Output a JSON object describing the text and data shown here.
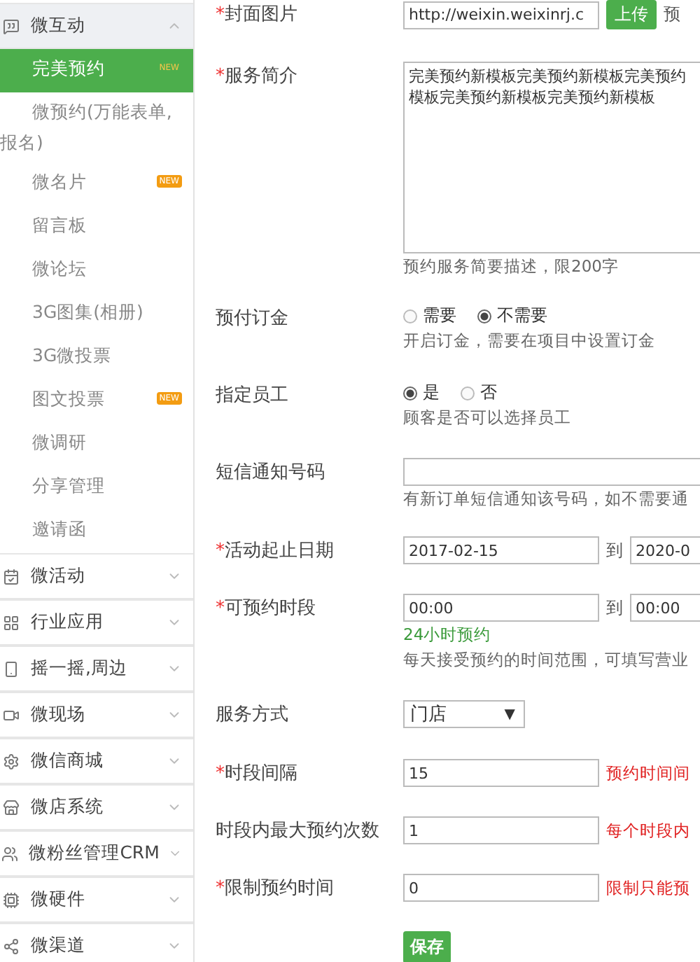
{
  "sidebar": {
    "groups": [
      {
        "label": "微互动",
        "expanded": true,
        "children": [
          {
            "label": "完美预约",
            "selected": true,
            "badge": "NEW"
          },
          {
            "label": "微预约(万能表单,报名)",
            "selected": false
          },
          {
            "label": "微名片",
            "selected": false,
            "badge": "NEW"
          },
          {
            "label": "留言板",
            "selected": false
          },
          {
            "label": "微论坛",
            "selected": false
          },
          {
            "label": "3G图集(相册)",
            "selected": false
          },
          {
            "label": "3G微投票",
            "selected": false
          },
          {
            "label": "图文投票",
            "selected": false,
            "badge": "NEW"
          },
          {
            "label": "微调研",
            "selected": false
          },
          {
            "label": "分享管理",
            "selected": false
          },
          {
            "label": "邀请函",
            "selected": false
          }
        ]
      },
      {
        "label": "微活动",
        "expanded": false
      },
      {
        "label": "行业应用",
        "expanded": false
      },
      {
        "label": "摇一摇,周边",
        "expanded": false
      },
      {
        "label": "微现场",
        "expanded": false
      },
      {
        "label": "微信商城",
        "expanded": false
      },
      {
        "label": "微店系统",
        "expanded": false
      },
      {
        "label": "微粉丝管理CRM",
        "expanded": false
      },
      {
        "label": "微硬件",
        "expanded": false
      },
      {
        "label": "微渠道",
        "expanded": false
      }
    ]
  },
  "form": {
    "fields": [
      {
        "kind": "upload",
        "mark": "*",
        "label": "封面图片",
        "value": "http://weixin.weixinrj.c",
        "button": "上传",
        "extra": "预"
      },
      {
        "kind": "textarea",
        "mark": "*",
        "label": "服务简介",
        "value_lines": [
          "完美预约新模板完美预约新模板完美预约",
          "模板完美预约新模板完美预约新模板"
        ],
        "hints": [
          {
            "text": "预约服务简要描述，限200字",
            "color": "#666666"
          }
        ]
      },
      {
        "kind": "radio",
        "label": "预付订金",
        "options": [
          {
            "label": "需要",
            "selected": false
          },
          {
            "label": "不需要",
            "selected": true
          }
        ],
        "hints": [
          {
            "text": "开启订金，需要在项目中设置订金",
            "color": "#666666"
          }
        ]
      },
      {
        "kind": "radio",
        "label": "指定员工",
        "options": [
          {
            "label": "是",
            "selected": true
          },
          {
            "label": "否",
            "selected": false
          }
        ],
        "hints": [
          {
            "text": "顾客是否可以选择员工",
            "color": "#666666"
          }
        ]
      },
      {
        "kind": "wide_text",
        "label": "短信通知号码",
        "hints": [
          {
            "text": "有新订单短信通知该号码，如不需要通",
            "color": "#666666"
          }
        ]
      },
      {
        "kind": "range",
        "mark": "*",
        "label": "活动起止日期",
        "from": "2017-02-15",
        "sep": "到",
        "to": "2020-0"
      },
      {
        "kind": "range",
        "mark": "*",
        "label": "可预约时段",
        "from": "00:00",
        "sep": "到",
        "to": "00:00",
        "hints": [
          {
            "text": "24小时预约",
            "color": "#3a9a3a"
          },
          {
            "text": "每天接受预约的时间范围，可填写营业",
            "color": "#666666"
          }
        ]
      },
      {
        "kind": "select",
        "label": "服务方式",
        "value": "门店",
        "arrow": "▼"
      },
      {
        "kind": "text",
        "mark": "*",
        "label": "时段间隔",
        "value": "15",
        "side": "预约时间间"
      },
      {
        "kind": "text",
        "label": "时段内最大预约次数",
        "value": "1",
        "side": "每个时段内"
      },
      {
        "kind": "text",
        "mark": "*",
        "label": "限制预约时间",
        "value": "0",
        "side": "限制只能预"
      },
      {
        "kind": "button",
        "label": "保存"
      }
    ]
  }
}
